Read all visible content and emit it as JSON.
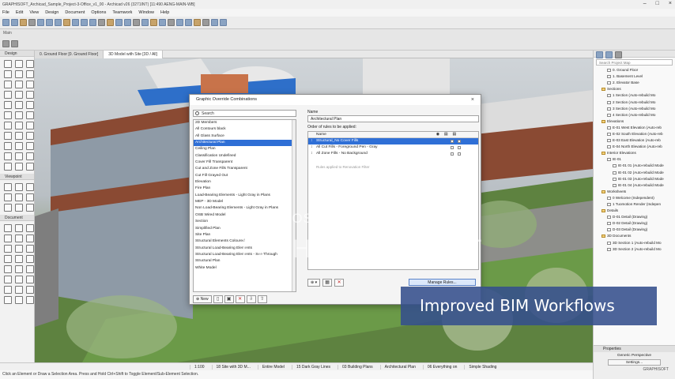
{
  "window": {
    "title": "GRAPHISOFT_Archicad_Sample_Project-3-Office_v1_00 - Archicad v26 (3271INT) [11:490 AENG-MAIN-WB]"
  },
  "menu": [
    "File",
    "Edit",
    "View",
    "Design",
    "Document",
    "Options",
    "Teamwork",
    "Window",
    "Help"
  ],
  "main_label": "Main",
  "toolbox": {
    "design": "Design",
    "viewpoint": "Viewpoint",
    "document": "Document"
  },
  "tabs": [
    "0. Ground Floor [0. Ground Floor]",
    "3D Model with Site [3D / All]"
  ],
  "dialog": {
    "title": "Graphic Override Combinations",
    "search_value": "Search",
    "combinations": [
      "2D Members",
      "All Contours black",
      "All Glass Surface",
      "Architectural Plan",
      "Ceiling Plan",
      "Classification Undefined",
      "Cover Fill Transparent",
      "Cut and Zone Fills Transparent",
      "Cut Fill Grayed Out",
      "Elevation",
      "Fire Plan",
      "Load-Bearing Elements - Light Gray in Plans",
      "MEP - 3D Model",
      "Non Load-Bearing Elements - Light Gray in Plans",
      "OSB Wired Model",
      "Section",
      "Simplified Plan",
      "Site Plan",
      "Structural Elements Coloured",
      "Structural Load-Bearing Elements",
      "Structural Load-Bearing Elements - See Through",
      "Structural Plan",
      "White Model"
    ],
    "selected_index": 3,
    "new_label": "New",
    "name_label": "Name",
    "name_value": "Architectural Plan",
    "order_label": "Order of rules to be applied:",
    "rules_header": "Name",
    "rules": [
      "Structural_No Cover Fills",
      "All Cut Fills - Foreground Pen - Gray",
      "All Zone Fills - No Background"
    ],
    "rules_hint": "Rules applied to Renovation Filter",
    "manage_label": "Manage Rules..."
  },
  "navigator": {
    "search_placeholder": "Search Project Map",
    "items": [
      {
        "t": "0. Ground Floor",
        "g": false,
        "i": 1
      },
      {
        "t": "1. Basement Level",
        "g": false,
        "i": 1
      },
      {
        "t": "2. Elevator Base",
        "g": false,
        "i": 1
      },
      {
        "t": "Sections",
        "g": true,
        "i": 0
      },
      {
        "t": "1 Section (Auto-rebuild Mo",
        "g": false,
        "i": 1
      },
      {
        "t": "2 Section (Auto-rebuild Mo",
        "g": false,
        "i": 1
      },
      {
        "t": "3 Section (Auto-rebuild Mo",
        "g": false,
        "i": 1
      },
      {
        "t": "4 Section (Auto-rebuild Mo",
        "g": false,
        "i": 1
      },
      {
        "t": "Elevations",
        "g": true,
        "i": 0
      },
      {
        "t": "E-01 West Elevation (Auto-reb",
        "g": false,
        "i": 1
      },
      {
        "t": "E-02 South Elevation (Auto-reb",
        "g": false,
        "i": 1
      },
      {
        "t": "E-03 East Elevation (Auto-reb",
        "g": false,
        "i": 1
      },
      {
        "t": "E-04 North Elevation (Auto-reb",
        "g": false,
        "i": 1
      },
      {
        "t": "Interior Elevations",
        "g": true,
        "i": 0
      },
      {
        "t": "IE-01",
        "g": false,
        "i": 1
      },
      {
        "t": "IE-01 01 (Auto-rebuild Mode",
        "g": false,
        "i": 2
      },
      {
        "t": "IE-01 02 (Auto-rebuild Mode",
        "g": false,
        "i": 2
      },
      {
        "t": "IE-01 03 (Auto-rebuild Mode",
        "g": false,
        "i": 2
      },
      {
        "t": "IE-01 04 (Auto-rebuild Mode",
        "g": false,
        "i": 2
      },
      {
        "t": "Worksheets",
        "g": true,
        "i": 0
      },
      {
        "t": "0 Welcome (Independent)",
        "g": false,
        "i": 1
      },
      {
        "t": "1 Tuomotion Render (Indepen",
        "g": false,
        "i": 1
      },
      {
        "t": "Details",
        "g": true,
        "i": 0
      },
      {
        "t": "D-01 Detail (Drawing)",
        "g": false,
        "i": 1
      },
      {
        "t": "D-02 Detail (Drawing)",
        "g": false,
        "i": 1
      },
      {
        "t": "D-03 Detail (Drawing)",
        "g": false,
        "i": 1
      },
      {
        "t": "3D Documents",
        "g": true,
        "i": 0
      },
      {
        "t": "3D Section 1 (Auto-rebuild Mo",
        "g": false,
        "i": 1
      },
      {
        "t": "3D Section 2 (Auto-rebuild Mo",
        "g": false,
        "i": 1
      }
    ]
  },
  "properties": {
    "title": "Properties",
    "value": "Generic Perspective",
    "settings": "Settings...",
    "logo": "GRAPHISOFT"
  },
  "status": [
    "1:100",
    "18 Site with 3D M...",
    "Entire Model",
    "15 Dark Gray Lines",
    "03 Building Plans",
    "Architectural Plan",
    "06 Everything on",
    "Simple Shading"
  ],
  "hint": "Click an Element or Draw a Selection Area. Press and Hold Ctrl+Shift to Toggle Element/Sub-Element Selection.",
  "overlay": {
    "watermark_top": "POSTED ON JIJI",
    "watermark_bottom": "LETHAL INSTINCT",
    "banner": "Improved BIM Workflows"
  }
}
